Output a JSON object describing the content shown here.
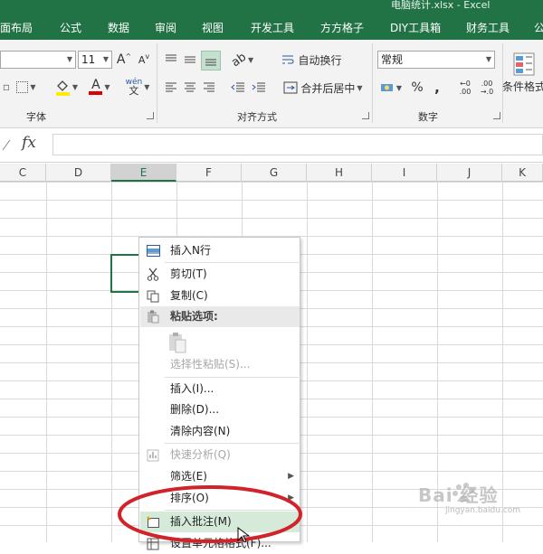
{
  "window": {
    "title": "电脑统计.xlsx - Excel"
  },
  "tabs": [
    "面布局",
    "公式",
    "数据",
    "审阅",
    "视图",
    "开发工具",
    "方方格子",
    "DIY工具箱",
    "财务工具",
    "公"
  ],
  "ribbon": {
    "font_size": "11",
    "font_group_label": "字体",
    "align_group_label": "对齐方式",
    "wrap_text_label": "自动换行",
    "merge_center_label": "合并后居中",
    "number_format": "常规",
    "number_group_label": "数字",
    "conditional_format_label": "条件格式",
    "percent_glyph": "%",
    "comma_glyph": ",",
    "increase_font_glyph": "A",
    "decrease_font_glyph": "A",
    "font_color_glyph": "A",
    "phonetic_glyph": "wén"
  },
  "formula_bar": {
    "fx_label": "fx",
    "value": ""
  },
  "columns": [
    "C",
    "D",
    "E",
    "F",
    "G",
    "H",
    "I",
    "J",
    "K"
  ],
  "selected_column": "E",
  "context_menu": {
    "items": [
      {
        "label": "插入N行",
        "icon": "insert-rows-icon"
      },
      {
        "label": "剪切(T)",
        "icon": "scissors-icon"
      },
      {
        "label": "复制(C)",
        "icon": "copy-icon"
      },
      {
        "label": "粘贴选项:",
        "icon": "paste-icon"
      },
      {
        "label": "选择性粘贴(S)...",
        "icon": ""
      },
      {
        "label": "插入(I)...",
        "icon": ""
      },
      {
        "label": "删除(D)...",
        "icon": ""
      },
      {
        "label": "清除内容(N)",
        "icon": ""
      },
      {
        "label": "快速分析(Q)",
        "icon": "quick-analysis-icon"
      },
      {
        "label": "筛选(E)",
        "icon": ""
      },
      {
        "label": "排序(O)",
        "icon": ""
      },
      {
        "label": "插入批注(M)",
        "icon": "insert-comment-icon"
      },
      {
        "label": "设置单元格格式(F)...",
        "icon": "format-cells-icon"
      }
    ]
  },
  "watermark": {
    "text": "Bai 经验",
    "url": "jingyan.baidu.com"
  },
  "colors": {
    "excel_green": "#217346",
    "highlight": "#d6ead9",
    "annotation_red": "#d0232a"
  }
}
